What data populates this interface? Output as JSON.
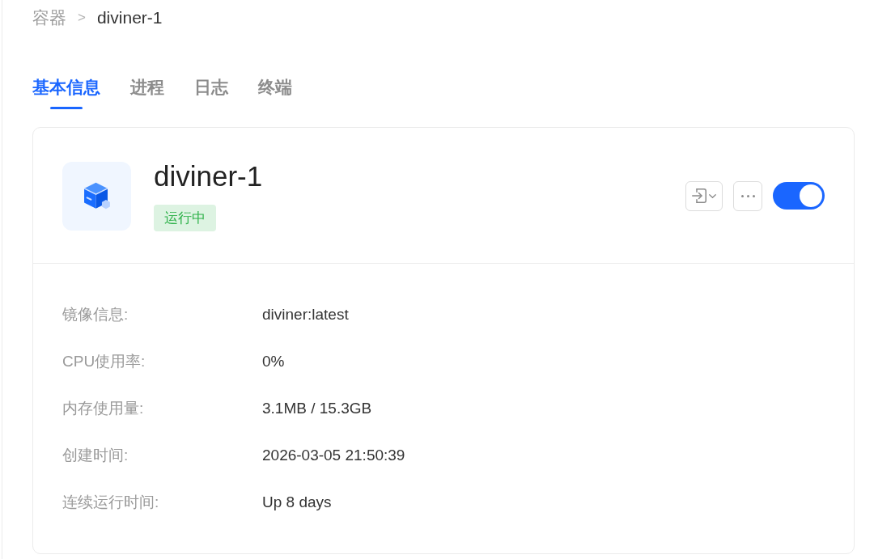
{
  "breadcrumb": {
    "items": [
      "容器",
      "diviner-1"
    ],
    "separator": ">"
  },
  "tabs": [
    {
      "label": "基本信息",
      "selected": true
    },
    {
      "label": "进程",
      "selected": false
    },
    {
      "label": "日志",
      "selected": false
    },
    {
      "label": "终端",
      "selected": false
    }
  ],
  "container": {
    "name": "diviner-1",
    "status": {
      "label": "运行中",
      "kind": "running"
    },
    "toggle": {
      "on": true
    }
  },
  "details": [
    {
      "label": "镜像信息:",
      "value": "diviner:latest"
    },
    {
      "label": "CPU使用率:",
      "value": "0%"
    },
    {
      "label": "内存使用量:",
      "value": "3.1MB / 15.3GB"
    },
    {
      "label": "创建时间:",
      "value": "2026-03-05 21:50:39"
    },
    {
      "label": "连续运行时间:",
      "value": "Up 8 days"
    }
  ]
}
